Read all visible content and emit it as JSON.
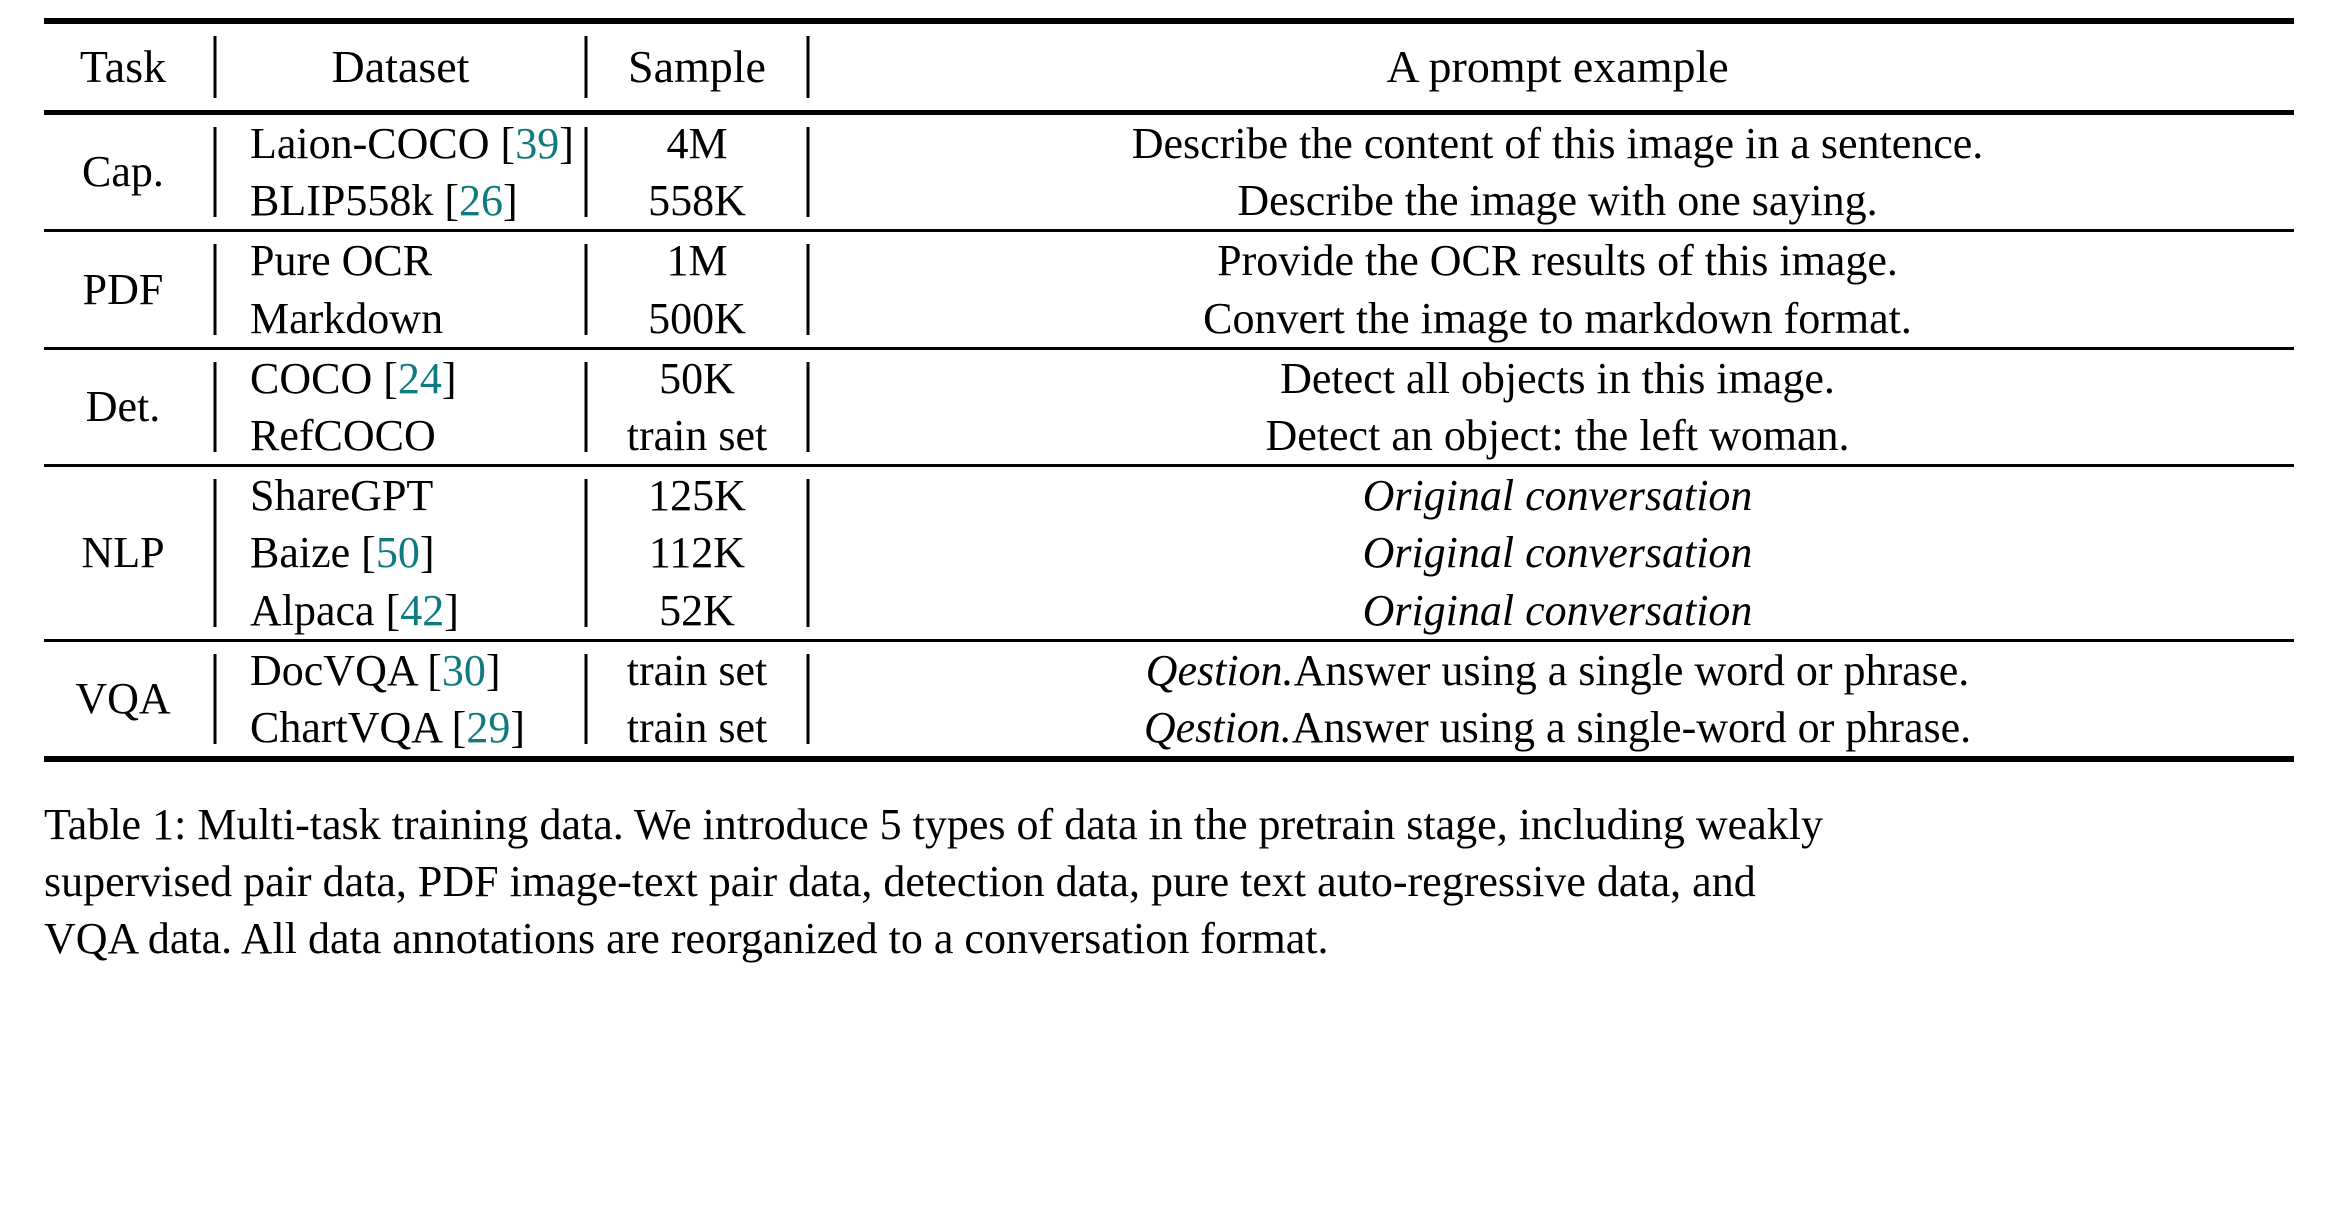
{
  "table": {
    "headers": {
      "task": "Task",
      "dataset": "Dataset",
      "sample": "Sample",
      "prompt": "A prompt example"
    },
    "groups": [
      {
        "task": "Cap.",
        "rows": [
          {
            "dataset_name": "Laion-COCO",
            "citation": "39",
            "sample": "4M",
            "prompt": "Describe the content of this image in a sentence.",
            "prompt_italic_prefix": ""
          },
          {
            "dataset_name": "BLIP558k",
            "citation": "26",
            "sample": "558K",
            "prompt": "Describe the image with one saying.",
            "prompt_italic_prefix": ""
          }
        ]
      },
      {
        "task": "PDF",
        "rows": [
          {
            "dataset_name": "Pure OCR",
            "citation": "",
            "sample": "1M",
            "prompt": "Provide the OCR results of this image.",
            "prompt_italic_prefix": ""
          },
          {
            "dataset_name": "Markdown",
            "citation": "",
            "sample": "500K",
            "prompt": "Convert the image to markdown format.",
            "prompt_italic_prefix": ""
          }
        ]
      },
      {
        "task": "Det.",
        "rows": [
          {
            "dataset_name": "COCO",
            "citation": "24",
            "sample": "50K",
            "prompt": "Detect all objects in this image.",
            "prompt_italic_prefix": ""
          },
          {
            "dataset_name": "RefCOCO",
            "citation": "",
            "sample": "train set",
            "prompt": "Detect an object: the left woman.",
            "prompt_italic_prefix": ""
          }
        ]
      },
      {
        "task": "NLP",
        "rows": [
          {
            "dataset_name": "ShareGPT",
            "citation": "",
            "sample": "125K",
            "prompt": "",
            "prompt_italic_prefix": "Original conversation"
          },
          {
            "dataset_name": "Baize",
            "citation": "50",
            "sample": "112K",
            "prompt": "",
            "prompt_italic_prefix": "Original conversation"
          },
          {
            "dataset_name": "Alpaca",
            "citation": "42",
            "sample": "52K",
            "prompt": "",
            "prompt_italic_prefix": "Original conversation"
          }
        ]
      },
      {
        "task": "VQA",
        "rows": [
          {
            "dataset_name": "DocVQA",
            "citation": "30",
            "sample": "train set",
            "prompt": "Answer using a single word or phrase.",
            "prompt_italic_prefix": "Qestion."
          },
          {
            "dataset_name": "ChartVQA",
            "citation": "29",
            "sample": "train set",
            "prompt": "Answer using a single-word or phrase.",
            "prompt_italic_prefix": "Qestion."
          }
        ]
      }
    ]
  },
  "caption": {
    "lines": [
      "Table 1: Multi-task training data. We introduce 5 types of data in the pretrain stage, including weakly",
      "supervised pair data, PDF image-text pair data, detection data, pure text auto-regressive data, and",
      "VQA data.  All data annotations are reorganized to a conversation format."
    ]
  },
  "colors": {
    "citation_teal": "#0e7b7f",
    "rule_black": "#000000",
    "text_black": "#000000",
    "background": "#ffffff"
  }
}
